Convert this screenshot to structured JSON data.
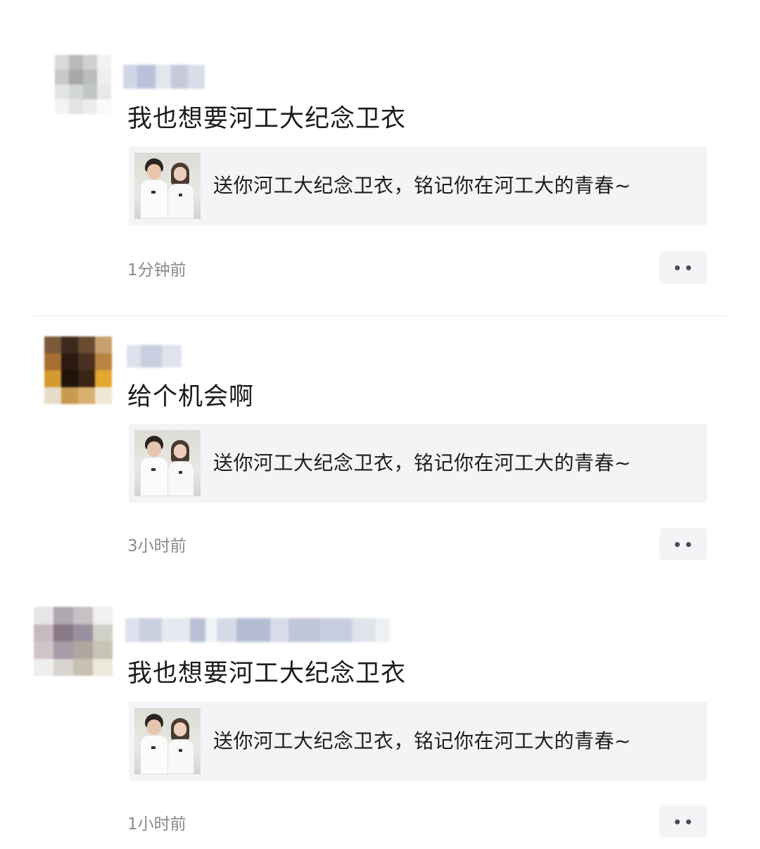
{
  "posts": [
    {
      "text": "我也想要河工大纪念卫衣",
      "link_title": "送你河工大纪念卫衣，铭记你在河工大的青春~",
      "time": "1分钟前"
    },
    {
      "text": "给个机会啊",
      "link_title": "送你河工大纪念卫衣，铭记你在河工大的青春~",
      "time": "3小时前"
    },
    {
      "text": "我也想要河工大纪念卫衣",
      "link_title": "送你河工大纪念卫衣，铭记你在河工大的青春~",
      "time": "1小时前"
    }
  ],
  "icons": {
    "more": "more-dots-icon",
    "avatar": "avatar-icon",
    "thumbnail": "couple-hoodie-thumbnail"
  },
  "colors": {
    "background": "#ffffff",
    "card_background": "#f4f4f6",
    "time_text": "#8a8a8a",
    "more_dots": "#4a4a5a"
  }
}
